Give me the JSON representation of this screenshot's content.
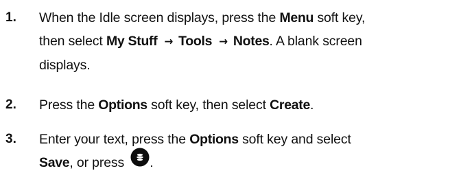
{
  "steps": [
    {
      "number": "1.",
      "parts": {
        "t1": "When the Idle screen displays, press the ",
        "b1": "Menu",
        "t2": " soft key,",
        "t3": "then select ",
        "b2": "My Stuff",
        "arrow": "→",
        "b3": "Tools",
        "b4": "Notes",
        "t4": ". A blank screen",
        "t5": "displays."
      }
    },
    {
      "number": "2.",
      "parts": {
        "t1": "Press the ",
        "b1": "Options",
        "t2": " soft key, then select ",
        "b2": "Create",
        "t3": "."
      }
    },
    {
      "number": "3.",
      "parts": {
        "t1": "Enter your text, press the ",
        "b1": "Options",
        "t2": " soft key and select",
        "b2": "Save",
        "t3": ", or press ",
        "t4": ".",
        "key_icon": "center-select-key-icon"
      }
    }
  ]
}
